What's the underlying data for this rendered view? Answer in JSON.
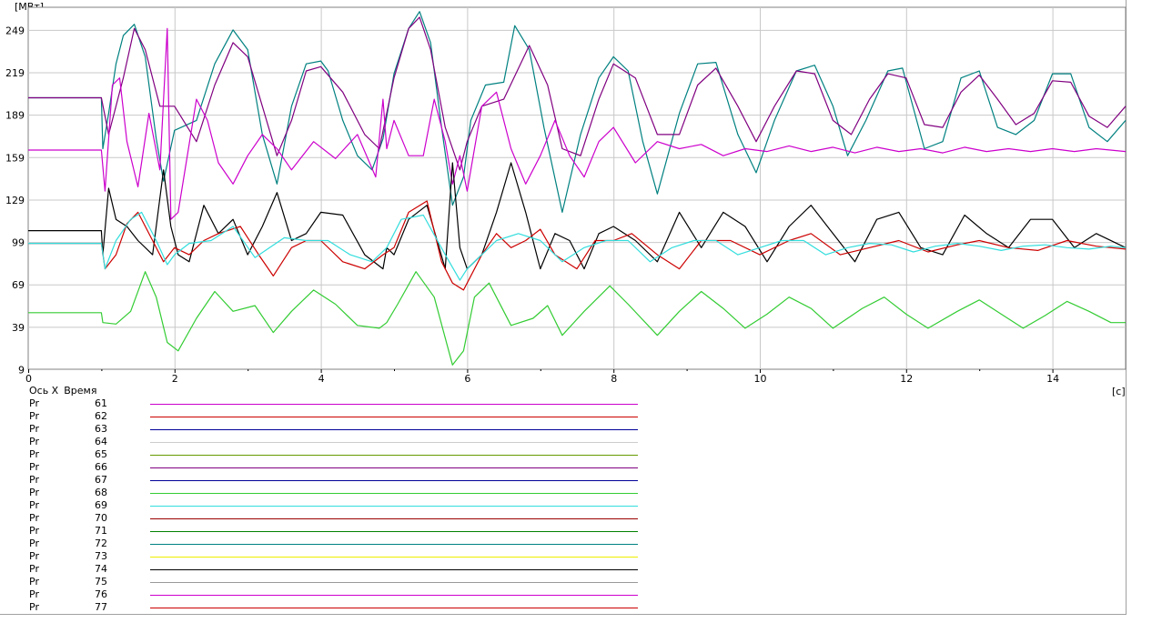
{
  "chart_data": {
    "type": "line",
    "y_unit": "[МВт]",
    "x_unit": "[с]",
    "xlim": [
      0,
      15
    ],
    "ylim": [
      9,
      265
    ],
    "grid": true,
    "x_ticks": [
      "0",
      "2",
      "4",
      "6",
      "8",
      "10",
      "12",
      "14"
    ],
    "x_tick_values": [
      0,
      2,
      4,
      6,
      8,
      10,
      12,
      14
    ],
    "y_ticks": [
      "9",
      "39",
      "69",
      "99",
      "129",
      "159",
      "189",
      "219",
      "249"
    ],
    "y_tick_values": [
      9,
      39,
      69,
      99,
      129,
      159,
      189,
      219,
      249
    ],
    "series": [
      {
        "id": "teal",
        "color": "#008080",
        "x": [
          0,
          1.0,
          1.02,
          1.1,
          1.2,
          1.3,
          1.45,
          1.6,
          1.75,
          1.85,
          2.0,
          2.3,
          2.55,
          2.8,
          3.0,
          3.2,
          3.4,
          3.6,
          3.8,
          4.0,
          4.1,
          4.3,
          4.5,
          4.7,
          4.85,
          5.0,
          5.2,
          5.35,
          5.5,
          5.65,
          5.8,
          5.95,
          6.05,
          6.25,
          6.5,
          6.65,
          6.85,
          7.05,
          7.3,
          7.55,
          7.8,
          8.0,
          8.2,
          8.4,
          8.6,
          8.9,
          9.15,
          9.4,
          9.7,
          9.95,
          10.2,
          10.5,
          10.75,
          11.0,
          11.2,
          11.45,
          11.75,
          11.95,
          12.25,
          12.5,
          12.75,
          13.0,
          13.25,
          13.5,
          13.75,
          14.0,
          14.25,
          14.5,
          14.75,
          15.0
        ],
        "y": [
          201,
          201,
          165,
          190,
          225,
          245,
          253,
          230,
          172,
          142,
          178,
          185,
          225,
          249,
          235,
          175,
          140,
          195,
          225,
          227,
          220,
          185,
          160,
          150,
          172,
          218,
          250,
          262,
          240,
          180,
          125,
          145,
          185,
          210,
          212,
          252,
          235,
          180,
          120,
          175,
          215,
          230,
          220,
          170,
          133,
          190,
          225,
          226,
          175,
          148,
          185,
          220,
          224,
          195,
          160,
          185,
          220,
          222,
          165,
          170,
          215,
          220,
          180,
          175,
          185,
          218,
          218,
          180,
          170,
          185
        ]
      },
      {
        "id": "purple",
        "color": "#800080",
        "x": [
          0,
          1.0,
          1.1,
          1.3,
          1.45,
          1.6,
          1.8,
          2.0,
          2.3,
          2.55,
          2.8,
          3.0,
          3.2,
          3.4,
          3.6,
          3.8,
          4.0,
          4.3,
          4.6,
          4.8,
          5.0,
          5.2,
          5.35,
          5.5,
          5.7,
          5.9,
          6.0,
          6.2,
          6.5,
          6.85,
          7.1,
          7.3,
          7.55,
          7.8,
          8.0,
          8.3,
          8.6,
          8.9,
          9.15,
          9.4,
          9.7,
          9.95,
          10.2,
          10.5,
          10.75,
          11.0,
          11.25,
          11.5,
          11.75,
          12.0,
          12.25,
          12.5,
          12.75,
          13.0,
          13.25,
          13.5,
          13.75,
          14.0,
          14.25,
          14.5,
          14.75,
          15.0
        ],
        "y": [
          201,
          201,
          175,
          215,
          250,
          235,
          195,
          195,
          170,
          210,
          240,
          230,
          195,
          160,
          185,
          220,
          223,
          205,
          175,
          165,
          215,
          250,
          258,
          235,
          180,
          150,
          170,
          195,
          200,
          238,
          210,
          165,
          160,
          200,
          225,
          215,
          175,
          175,
          210,
          222,
          195,
          170,
          195,
          220,
          218,
          185,
          175,
          200,
          218,
          215,
          182,
          180,
          205,
          217,
          200,
          182,
          190,
          213,
          212,
          188,
          180,
          195
        ]
      },
      {
        "id": "magenta",
        "color": "#cc00cc",
        "x": [
          0,
          1.0,
          1.05,
          1.15,
          1.25,
          1.35,
          1.5,
          1.65,
          1.8,
          1.9,
          1.95,
          2.05,
          2.3,
          2.45,
          2.6,
          2.8,
          3.0,
          3.2,
          3.4,
          3.6,
          3.9,
          4.2,
          4.5,
          4.75,
          4.85,
          4.9,
          5.0,
          5.2,
          5.4,
          5.55,
          5.7,
          5.8,
          5.9,
          6.0,
          6.2,
          6.4,
          6.6,
          6.8,
          7.0,
          7.2,
          7.4,
          7.6,
          7.8,
          8.0,
          8.3,
          8.6,
          8.9,
          9.2,
          9.5,
          9.8,
          10.1,
          10.4,
          10.7,
          11.0,
          11.3,
          11.6,
          11.9,
          12.2,
          12.5,
          12.8,
          13.1,
          13.4,
          13.7,
          14.0,
          14.3,
          14.6,
          15.0
        ],
        "y": [
          164,
          164,
          135,
          210,
          215,
          170,
          138,
          190,
          150,
          250,
          115,
          120,
          200,
          185,
          155,
          140,
          160,
          175,
          165,
          150,
          170,
          158,
          175,
          145,
          200,
          165,
          185,
          160,
          160,
          200,
          170,
          140,
          160,
          135,
          195,
          205,
          165,
          140,
          160,
          185,
          160,
          145,
          170,
          180,
          155,
          170,
          165,
          168,
          160,
          165,
          163,
          167,
          163,
          166,
          162,
          166,
          163,
          165,
          162,
          166,
          163,
          165,
          163,
          165,
          163,
          165,
          163
        ]
      },
      {
        "id": "black",
        "color": "#000000",
        "x": [
          0,
          1.0,
          1.02,
          1.1,
          1.2,
          1.35,
          1.5,
          1.7,
          1.85,
          1.95,
          2.05,
          2.2,
          2.4,
          2.6,
          2.8,
          3.0,
          3.2,
          3.4,
          3.6,
          3.8,
          4.0,
          4.3,
          4.6,
          4.85,
          4.9,
          5.0,
          5.2,
          5.45,
          5.7,
          5.8,
          5.9,
          6.0,
          6.2,
          6.4,
          6.6,
          6.8,
          7.0,
          7.2,
          7.4,
          7.6,
          7.8,
          8.0,
          8.3,
          8.6,
          8.9,
          9.2,
          9.5,
          9.8,
          10.1,
          10.4,
          10.7,
          11.0,
          11.3,
          11.6,
          11.9,
          12.2,
          12.5,
          12.8,
          13.1,
          13.4,
          13.7,
          14.0,
          14.3,
          14.6,
          15.0
        ],
        "y": [
          107,
          107,
          90,
          137,
          115,
          110,
          100,
          90,
          150,
          110,
          90,
          85,
          125,
          105,
          115,
          90,
          110,
          134,
          100,
          105,
          120,
          118,
          90,
          80,
          95,
          90,
          115,
          125,
          80,
          155,
          95,
          80,
          90,
          120,
          155,
          120,
          80,
          105,
          100,
          80,
          105,
          110,
          100,
          85,
          120,
          95,
          120,
          110,
          85,
          110,
          125,
          105,
          85,
          115,
          120,
          95,
          90,
          118,
          105,
          95,
          115,
          115,
          95,
          105,
          95
        ]
      },
      {
        "id": "red",
        "color": "#cc0000",
        "x": [
          0,
          1.0,
          1.05,
          1.2,
          1.35,
          1.5,
          1.7,
          1.85,
          2.0,
          2.2,
          2.4,
          2.6,
          2.9,
          3.15,
          3.35,
          3.6,
          3.8,
          4.0,
          4.3,
          4.6,
          4.85,
          5.0,
          5.2,
          5.45,
          5.65,
          5.8,
          5.95,
          6.0,
          6.2,
          6.4,
          6.6,
          6.8,
          7.0,
          7.2,
          7.5,
          7.75,
          8.0,
          8.25,
          8.6,
          8.9,
          9.2,
          9.6,
          10.0,
          10.4,
          10.7,
          11.1,
          11.5,
          11.9,
          12.3,
          12.7,
          13.0,
          13.4,
          13.8,
          14.2,
          14.6,
          15.0
        ],
        "y": [
          98,
          98,
          80,
          90,
          112,
          120,
          100,
          85,
          95,
          90,
          100,
          105,
          110,
          90,
          75,
          95,
          100,
          100,
          85,
          80,
          90,
          95,
          120,
          128,
          85,
          70,
          65,
          70,
          90,
          105,
          95,
          100,
          108,
          90,
          80,
          100,
          100,
          105,
          90,
          80,
          100,
          100,
          90,
          100,
          105,
          90,
          95,
          100,
          92,
          97,
          100,
          95,
          93,
          100,
          96,
          94
        ]
      },
      {
        "id": "cyan",
        "color": "#33dddd",
        "x": [
          0,
          1.0,
          1.05,
          1.2,
          1.4,
          1.55,
          1.75,
          1.9,
          2.0,
          2.2,
          2.5,
          2.8,
          3.1,
          3.3,
          3.5,
          3.8,
          4.1,
          4.4,
          4.7,
          4.9,
          5.1,
          5.4,
          5.7,
          5.9,
          6.0,
          6.2,
          6.4,
          6.7,
          7.0,
          7.3,
          7.6,
          7.9,
          8.2,
          8.5,
          8.8,
          9.1,
          9.4,
          9.7,
          10.0,
          10.3,
          10.6,
          10.9,
          11.2,
          11.5,
          11.8,
          12.1,
          12.4,
          12.7,
          13.0,
          13.3,
          13.6,
          13.9,
          14.2,
          14.5,
          14.8,
          15.0
        ],
        "y": [
          98,
          98,
          80,
          100,
          115,
          120,
          100,
          83,
          90,
          98,
          100,
          110,
          88,
          95,
          102,
          100,
          100,
          90,
          85,
          95,
          115,
          118,
          90,
          72,
          80,
          90,
          100,
          105,
          100,
          85,
          95,
          100,
          100,
          85,
          95,
          100,
          100,
          90,
          95,
          100,
          100,
          90,
          95,
          98,
          97,
          92,
          96,
          98,
          96,
          93,
          96,
          97,
          95,
          94,
          96,
          95
        ]
      },
      {
        "id": "green",
        "color": "#33cc33",
        "x": [
          0,
          1.0,
          1.02,
          1.2,
          1.4,
          1.6,
          1.75,
          1.9,
          2.05,
          2.3,
          2.55,
          2.8,
          3.1,
          3.35,
          3.6,
          3.9,
          4.2,
          4.5,
          4.8,
          4.9,
          5.05,
          5.3,
          5.55,
          5.8,
          5.95,
          6.1,
          6.3,
          6.6,
          6.9,
          7.1,
          7.3,
          7.6,
          7.95,
          8.2,
          8.6,
          8.9,
          9.2,
          9.5,
          9.8,
          10.1,
          10.4,
          10.7,
          11.0,
          11.4,
          11.7,
          12.0,
          12.3,
          12.7,
          13.0,
          13.3,
          13.6,
          13.9,
          14.2,
          14.5,
          14.8,
          15.0
        ],
        "y": [
          49,
          49,
          42,
          41,
          50,
          78,
          60,
          28,
          22,
          45,
          64,
          50,
          54,
          35,
          50,
          65,
          55,
          40,
          38,
          42,
          55,
          78,
          60,
          12,
          22,
          60,
          70,
          40,
          45,
          54,
          33,
          50,
          68,
          55,
          33,
          50,
          64,
          52,
          38,
          48,
          60,
          52,
          38,
          52,
          60,
          48,
          38,
          50,
          58,
          48,
          38,
          47,
          57,
          50,
          42,
          42
        ]
      }
    ]
  },
  "axis_x_header": {
    "label": "Ось X",
    "value": "Время"
  },
  "legend": [
    {
      "param": "Pr",
      "num": "61",
      "color": "#cc00cc"
    },
    {
      "param": "Pr",
      "num": "62",
      "color": "#cc0000"
    },
    {
      "param": "Pr",
      "num": "63",
      "color": "#000099"
    },
    {
      "param": "Pr",
      "num": "64",
      "color": "#cccccc"
    },
    {
      "param": "Pr",
      "num": "65",
      "color": "#669900"
    },
    {
      "param": "Pr",
      "num": "66",
      "color": "#800080"
    },
    {
      "param": "Pr",
      "num": "67",
      "color": "#000099"
    },
    {
      "param": "Pr",
      "num": "68",
      "color": "#33cc33"
    },
    {
      "param": "Pr",
      "num": "69",
      "color": "#33dddd"
    },
    {
      "param": "Pr",
      "num": "70",
      "color": "#990000"
    },
    {
      "param": "Pr",
      "num": "71",
      "color": "#008000"
    },
    {
      "param": "Pr",
      "num": "72",
      "color": "#008080"
    },
    {
      "param": "Pr",
      "num": "73",
      "color": "#eeee00"
    },
    {
      "param": "Pr",
      "num": "74",
      "color": "#000000"
    },
    {
      "param": "Pr",
      "num": "75",
      "color": "#999999"
    },
    {
      "param": "Pr",
      "num": "76",
      "color": "#cc00cc"
    },
    {
      "param": "Pr",
      "num": "77",
      "color": "#cc0000"
    }
  ]
}
